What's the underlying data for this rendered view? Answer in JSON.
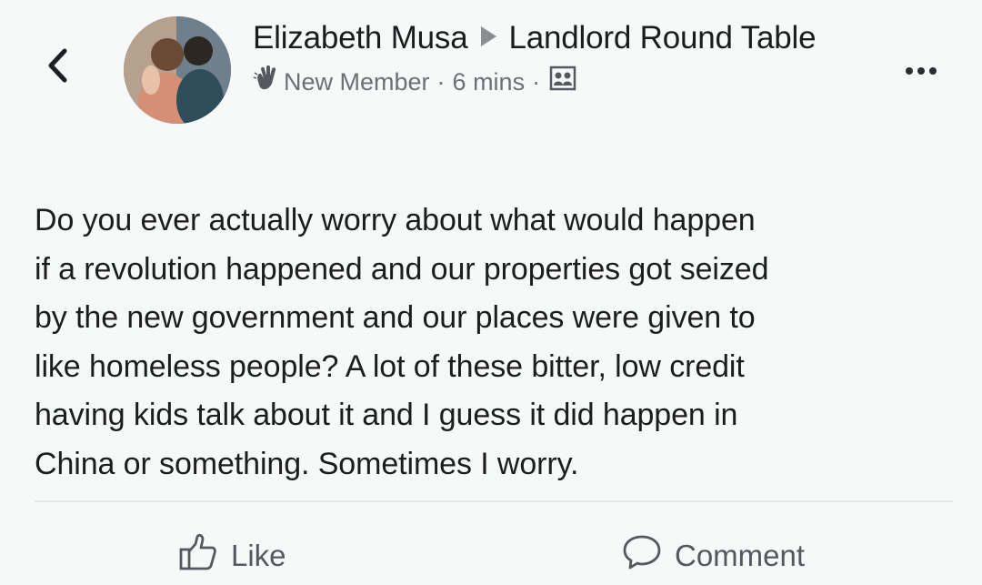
{
  "post": {
    "author": "Elizabeth Musa",
    "group": "Landlord Round Table",
    "badge": "New Member",
    "separator": "·",
    "time": "6 mins",
    "text": "Do you ever actually worry about what would happen\nif a revolution happened and our properties got seized\nby the new government and our places were given to\nlike homeless people?  A lot of these bitter, low credit\nhaving kids talk about it and I guess it did happen in\nChina or something.  Sometimes I worry."
  },
  "actions": {
    "like_label": "Like",
    "comment_label": "Comment"
  },
  "icons": {
    "back": "chevron-left-icon",
    "more": "more-horizontal-icon",
    "badge": "waving-hand-icon",
    "audience": "group-icon",
    "like": "thumbs-up-icon",
    "comment": "speech-bubble-icon"
  },
  "colors": {
    "background": "#f7f8f8",
    "text": "#1c1d1f",
    "secondary_text": "#6c6f74",
    "action_text": "#55585d",
    "divider": "#e3e5e8"
  }
}
